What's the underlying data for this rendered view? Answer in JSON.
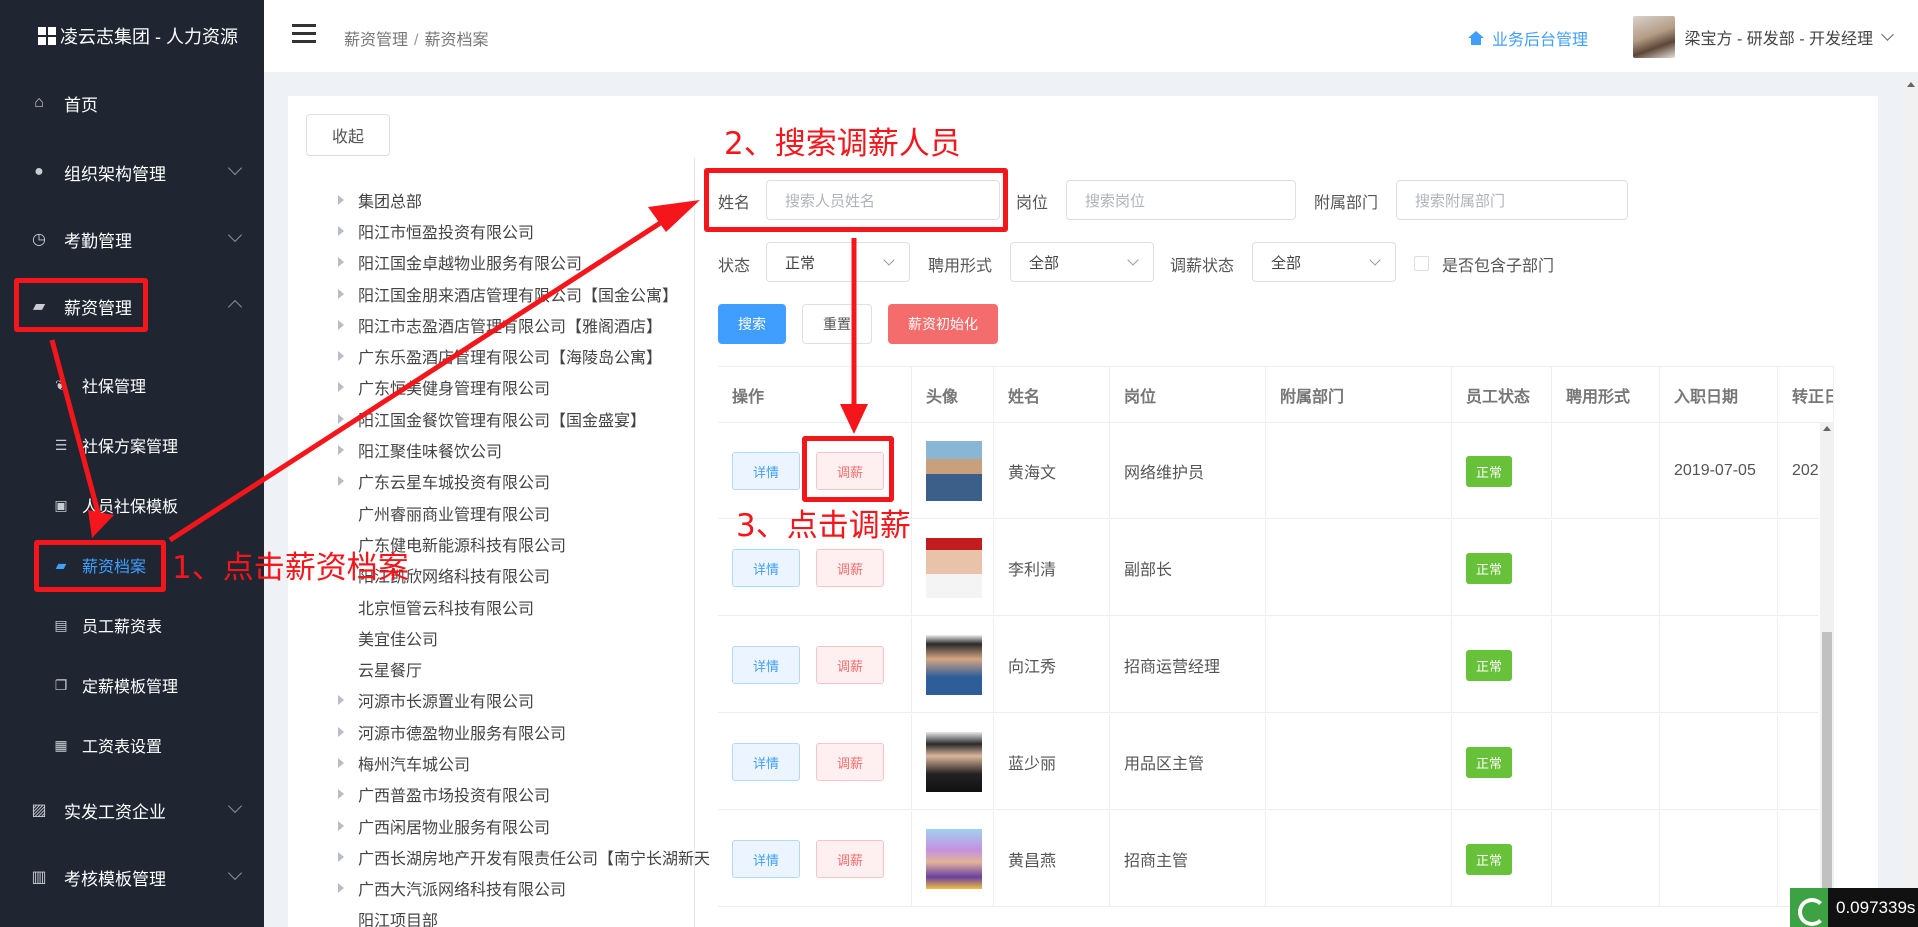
{
  "app": {
    "title": "凌云志集团 - 人力资源"
  },
  "sidebar": {
    "home": "首页",
    "org": "组织架构管理",
    "attendance": "考勤管理",
    "salary": "薪资管理",
    "sub": [
      "社保管理",
      "社保方案管理",
      "人员社保模板",
      "薪资档案",
      "员工薪资表",
      "定薪模板管理",
      "工资表设置"
    ],
    "pay_company": "实发工资企业",
    "assess": "考核模板管理"
  },
  "header": {
    "breadcrumb_parent": "薪资管理",
    "breadcrumb_sep": "/",
    "breadcrumb_current": "薪资档案",
    "biz_link": "业务后台管理",
    "user": "梁宝方 - 研发部 - 开发经理"
  },
  "panel": {
    "collapse": "收起"
  },
  "tree": [
    {
      "label": "集团总部",
      "expandable": true
    },
    {
      "label": "阳江市恒盈投资有限公司",
      "expandable": true
    },
    {
      "label": "阳江国金卓越物业服务有限公司",
      "expandable": true
    },
    {
      "label": "阳江国金朋来酒店管理有限公司【国金公寓】",
      "expandable": true
    },
    {
      "label": "阳江市志盈酒店管理有限公司【雅阁酒店】",
      "expandable": true
    },
    {
      "label": "广东乐盈酒店管理有限公司【海陵岛公寓】",
      "expandable": true
    },
    {
      "label": "广东恒美健身管理有限公司",
      "expandable": true
    },
    {
      "label": "阳江国金餐饮管理有限公司【国金盛宴】",
      "expandable": true
    },
    {
      "label": "阳江聚佳味餐饮公司",
      "expandable": true
    },
    {
      "label": "广东云星车城投资有限公司",
      "expandable": true
    },
    {
      "label": "广州睿丽商业管理有限公司",
      "expandable": false
    },
    {
      "label": "广东健电新能源科技有限公司",
      "expandable": false
    },
    {
      "label": "阳江凯欣网络科技有限公司",
      "expandable": false
    },
    {
      "label": "北京恒管云科技有限公司",
      "expandable": false
    },
    {
      "label": "美宜佳公司",
      "expandable": false
    },
    {
      "label": "云星餐厅",
      "expandable": false
    },
    {
      "label": "河源市长源置业有限公司",
      "expandable": true
    },
    {
      "label": "河源市德盈物业服务有限公司",
      "expandable": true
    },
    {
      "label": "梅州汽车城公司",
      "expandable": true
    },
    {
      "label": "广西普盈市场投资有限公司",
      "expandable": true
    },
    {
      "label": "广西闲居物业服务有限公司",
      "expandable": true
    },
    {
      "label": "广西长湖房地产开发有限责任公司【南宁长湖新天",
      "expandable": true
    },
    {
      "label": "广西大汽派网络科技有限公司",
      "expandable": true
    },
    {
      "label": "阳江项目部",
      "expandable": false
    }
  ],
  "filters": {
    "name_label": "姓名",
    "name_placeholder": "搜索人员姓名",
    "post_label": "岗位",
    "post_placeholder": "搜索岗位",
    "dept_label": "附属部门",
    "dept_placeholder": "搜索附属部门",
    "status_label": "状态",
    "status_value": "正常",
    "hire_label": "聘用形式",
    "hire_value": "全部",
    "adjust_label": "调薪状态",
    "adjust_value": "全部",
    "sub_dept_label": "是否包含子部门"
  },
  "actions": {
    "search": "搜索",
    "reset": "重置",
    "init": "薪资初始化"
  },
  "table": {
    "headers": [
      "操作",
      "头像",
      "姓名",
      "岗位",
      "附属部门",
      "员工状态",
      "聘用形式",
      "入职日期",
      "转正日"
    ],
    "detail_label": "详情",
    "adjust_label": "调薪",
    "rows": [
      {
        "name": "黄海文",
        "post": "网络维护员",
        "dept": "",
        "status": "正常",
        "hire": "",
        "join": "2019-07-05",
        "regular": "202"
      },
      {
        "name": "李利清",
        "post": "副部长",
        "dept": "",
        "status": "正常",
        "hire": "",
        "join": "",
        "regular": ""
      },
      {
        "name": "向江秀",
        "post": "招商运营经理",
        "dept": "",
        "status": "正常",
        "hire": "",
        "join": "",
        "regular": ""
      },
      {
        "name": "蓝少丽",
        "post": "用品区主管",
        "dept": "",
        "status": "正常",
        "hire": "",
        "join": "",
        "regular": ""
      },
      {
        "name": "黄昌燕",
        "post": "招商主管",
        "dept": "",
        "status": "正常",
        "hire": "",
        "join": "",
        "regular": ""
      }
    ]
  },
  "annotations": {
    "step1": "1、点击薪资档案",
    "step2": "2、搜索调薪人员",
    "step3": "3、点击调薪"
  },
  "timer": "0.097339s",
  "colors": {
    "sidebar_bg": "#1f2632",
    "primary": "#409eff",
    "danger": "#f56c6c",
    "success": "#67c23a",
    "annotation_red": "#f5161b"
  }
}
